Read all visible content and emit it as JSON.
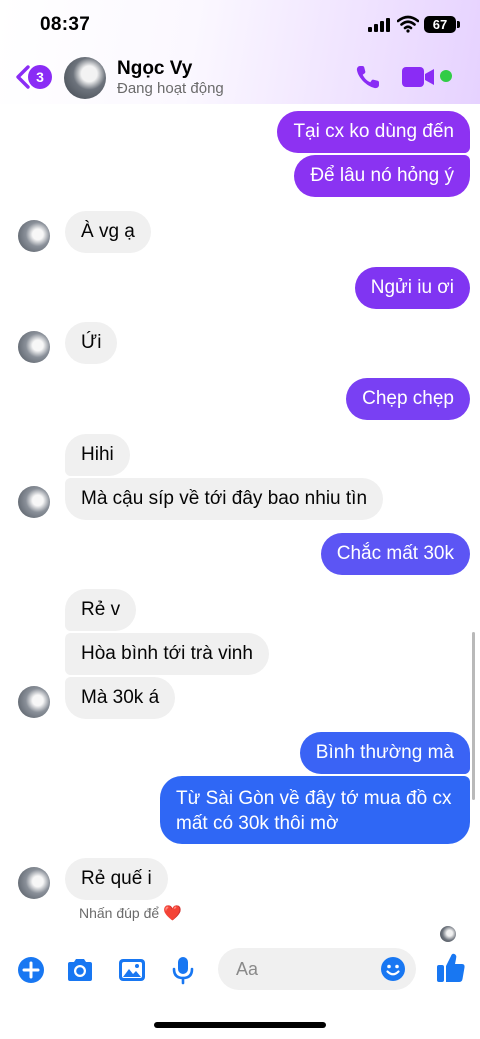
{
  "status_bar": {
    "time": "08:37",
    "battery": "67"
  },
  "header": {
    "back_badge": "3",
    "contact_name": "Ngọc Vy",
    "contact_status": "Đang hoạt động"
  },
  "messages": [
    {
      "text": "Tại cx ko dùng đến",
      "direction": "outgoing"
    },
    {
      "text": "Để lâu nó hỏng ý",
      "direction": "outgoing"
    },
    {
      "text": "À vg ạ",
      "direction": "incoming"
    },
    {
      "text": "Ngửi iu ơi",
      "direction": "outgoing"
    },
    {
      "text": "Ứi",
      "direction": "incoming"
    },
    {
      "text": "Chẹp chẹp",
      "direction": "outgoing"
    },
    {
      "text": "Hihi",
      "direction": "incoming"
    },
    {
      "text": "Mà cậu síp về tới đây bao nhiu tìn",
      "direction": "incoming"
    },
    {
      "text": "Chắc mất 30k",
      "direction": "outgoing"
    },
    {
      "text": "Rẻ v",
      "direction": "incoming"
    },
    {
      "text": "Hòa bình tới trà vinh",
      "direction": "incoming"
    },
    {
      "text": "Mà 30k á",
      "direction": "incoming"
    },
    {
      "text": "Bình thường mà",
      "direction": "outgoing"
    },
    {
      "text_line1": "Từ Sài Gòn về đây tớ mua đồ cx",
      "text_line2": "mất có 30k thôi mờ",
      "direction": "outgoing"
    },
    {
      "text": "Rẻ quế i",
      "direction": "incoming"
    }
  ],
  "reaction_hint": "Nhấn đúp để",
  "reaction_emoji": "❤️",
  "composer": {
    "placeholder": "Aa"
  },
  "icons": {
    "back": "chevron-left-icon",
    "call": "phone-icon",
    "video": "video-camera-icon",
    "add": "plus-icon",
    "camera": "camera-icon",
    "gallery": "image-icon",
    "mic": "microphone-icon",
    "emoji": "smiley-icon",
    "like": "thumbs-up-icon"
  },
  "colors": {
    "accent": "#8a2cf5",
    "bubble_gradient_top": "#9334f0",
    "bubble_gradient_bottom": "#2f67f5",
    "incoming_bubble": "#f0f0f0",
    "online": "#31cc46",
    "toolbar_blue": "#1877f2"
  }
}
